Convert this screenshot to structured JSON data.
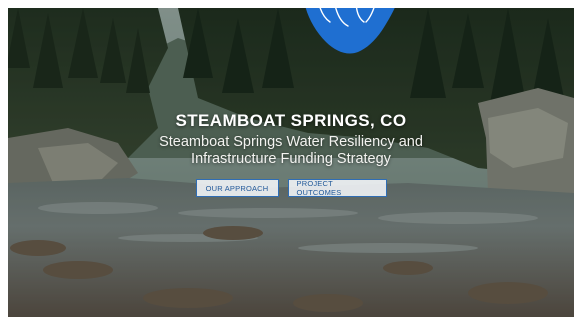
{
  "hero": {
    "title": "STEAMBOAT SPRINGS, CO",
    "subtitle": "Steamboat Springs Water Resiliency and Infrastructure Funding Strategy",
    "background_image": "river-forest-photo",
    "brand_mark_icon": "blue-hand-drawn-logo-icon"
  },
  "buttons": {
    "approach_label": "OUR APPROACH",
    "outcomes_label": "PROJECT OUTCOMES"
  },
  "colors": {
    "accent_blue": "#1f6fd1",
    "button_border": "#2f6db4",
    "button_text": "#235a9a",
    "title_text": "#ffffff"
  }
}
